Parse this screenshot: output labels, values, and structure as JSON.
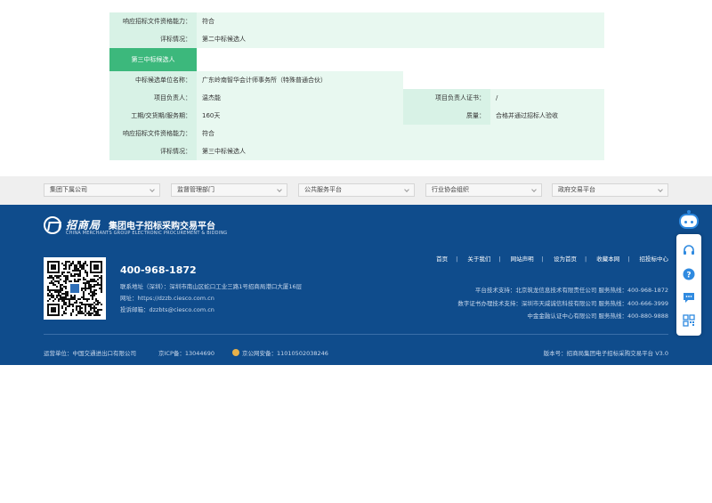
{
  "table": {
    "rows": [
      {
        "label": "响应招标文件资格能力：",
        "value": "符合"
      },
      {
        "label": "评标情况：",
        "value": "第二中标候选人"
      },
      {
        "section": "第三中标候选人"
      },
      {
        "label": "中标候选单位名称：",
        "value": "广东岭南智华会计师事务所（特殊普通合伙）"
      },
      {
        "label": "项目负责人：",
        "value": "温杰能",
        "label2": "项目负责人证书：",
        "value2": "/"
      },
      {
        "label": "工期/交货期/服务期：",
        "value": "160天",
        "label2": "质量：",
        "value2": "合格并通过招标人验收"
      },
      {
        "label": "响应招标文件资格能力：",
        "value": "符合"
      },
      {
        "label": "评标情况：",
        "value": "第三中标候选人"
      }
    ]
  },
  "linkbar": {
    "selects": [
      "集团下属公司",
      "监督管理部门",
      "公共服务平台",
      "行业协会组织",
      "政府交易平台"
    ]
  },
  "footer": {
    "logo_cn": "招商局",
    "logo_sub": "集团电子招标采购交易平台",
    "logo_en": "CHINA MERCHANTS GROUP ELECTRONIC PROCUREMENT & BIDDING",
    "hotline": "400-968-1872",
    "address": "联系地址（深圳）：深圳市南山区蛇口工业三路1号招商局港口大厦16层",
    "website": "网址：https://dzzb.ciesco.com.cn",
    "complaint_email": "投诉邮箱：dzzbts@ciesco.com.cn",
    "nav": [
      "首页",
      "关于我们",
      "网站声明",
      "设为首页",
      "收藏本网",
      "招投标中心"
    ],
    "support": [
      "平台技术支持：北京筑龙信息技术有限责任公司 服务热线：400-968-1872",
      "数字证书办理技术支持：深圳市天威诚信科技有限公司 服务热线：400-666-3999",
      "中金金融认证中心有限公司 服务热线：400-880-9888"
    ],
    "operator": "运营单位：中国交通进出口有限公司",
    "icp": "京ICP备：13044690",
    "police": "京公网安备：11010502038246",
    "version": "版本号：招商局集团电子招标采购交易平台 V3.0"
  },
  "widget": {
    "icons": [
      "customer-service-icon",
      "help-icon",
      "message-icon",
      "qrcode-icon"
    ],
    "accent": "#2f8ae0"
  },
  "colors": {
    "footer_bg": "#0f4c8c",
    "section_green": "#3cb87c",
    "label_bg": "#d8f2e6",
    "value_bg": "#e8f8f0"
  }
}
